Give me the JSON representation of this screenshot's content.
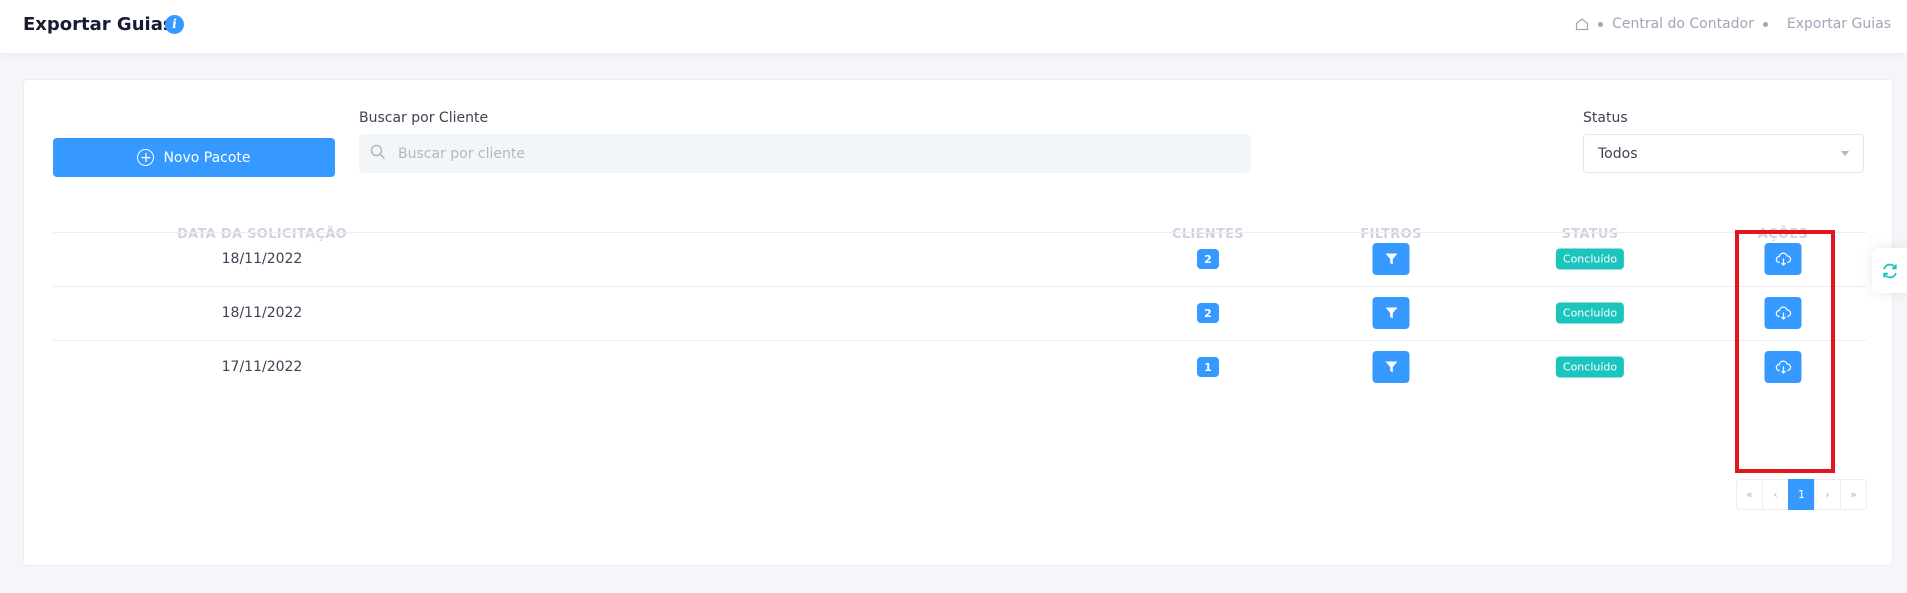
{
  "header": {
    "title": "Exportar Guias",
    "info_icon": "info-icon",
    "breadcrumb": [
      "Central do Contador",
      "Exportar Guias"
    ]
  },
  "toolbar": {
    "new_package_label": "Novo Pacote",
    "search_label": "Buscar por Cliente",
    "search_placeholder": "Buscar por cliente",
    "search_value": "",
    "status_label": "Status",
    "status_value": "Todos"
  },
  "table": {
    "columns": [
      "Data da Solicitação",
      "Clientes",
      "Filtros",
      "Status",
      "Ações"
    ],
    "rows": [
      {
        "date": "18/11/2022",
        "clients": "2",
        "status": "Concluído"
      },
      {
        "date": "18/11/2022",
        "clients": "2",
        "status": "Concluído"
      },
      {
        "date": "17/11/2022",
        "clients": "1",
        "status": "Concluído"
      }
    ]
  },
  "pagination": {
    "first": "«",
    "prev": "‹",
    "current": "1",
    "next": "›",
    "last": "»"
  },
  "colors": {
    "primary": "#3699ff",
    "success": "#1bc5bd",
    "highlight": "#e3161f"
  }
}
